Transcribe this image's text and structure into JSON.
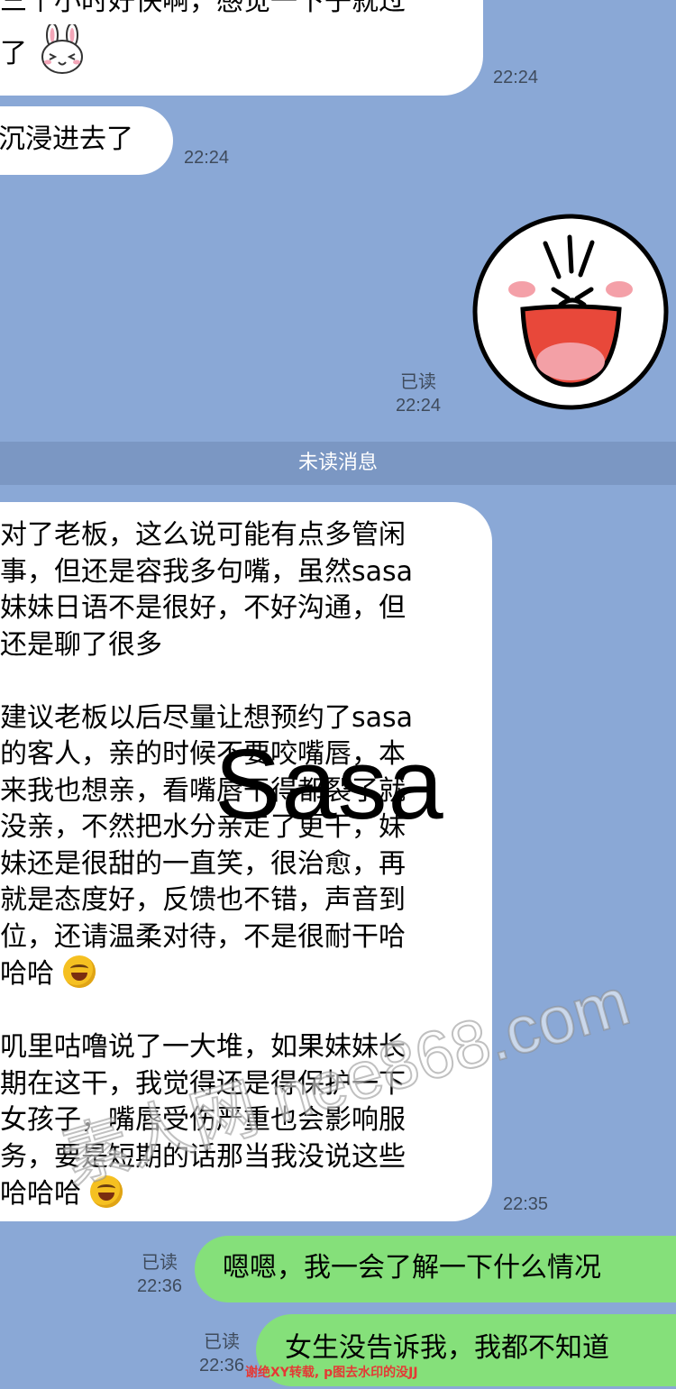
{
  "messages": {
    "m1": {
      "lines": [
        "三个小时好快啊，感觉一下子就过",
        "了"
      ],
      "time": "22:24"
    },
    "m2": {
      "text": "沉浸进去了",
      "time": "22:24"
    },
    "sticker": {
      "icon": "laughing-face-sticker",
      "read": "已读",
      "time": "22:24"
    },
    "m3": {
      "lines": [
        "对了老板，这么说可能有点多管闲",
        "事，但还是容我多句嘴，虽然sasa",
        "妹妹日语不是很好，不好沟通，但",
        "还是聊了很多",
        "",
        "建议老板以后尽量让想预约了sasa",
        "的客人，亲的时候不要咬嘴唇，本",
        "来我也想亲，看嘴唇干得都裂了就",
        "没亲，不然把水分亲走了更干，妹",
        "妹还是很甜的一直笑，很治愈，再",
        "就是态度好，反馈也不错，声音到",
        "位，还请温柔对待，不是很耐干哈",
        "哈哈",
        "",
        "叽里咕噜说了一大堆，如果妹妹长",
        "期在这干，我觉得还是得保护一下",
        "女孩子，嘴唇受伤严重也会影响服",
        "务，要是短期的话那当我没说这些",
        "哈哈哈"
      ],
      "time": "22:35"
    },
    "m4": {
      "text": "嗯嗯，我一会了解一下什么情况",
      "read": "已读",
      "time": "22:36"
    },
    "m5": {
      "text": "女生没告诉我，我都不知道",
      "read": "已读",
      "time": "22:36"
    }
  },
  "divider_label": "未读消息",
  "watermarks": {
    "name": "Sasa",
    "url": "素人网 nee868.com"
  },
  "footer_note": "谢绝XY转载, p图去水印的没JJ",
  "colors": {
    "background": "#8aa8d6",
    "incoming": "#ffffff",
    "outgoing": "#85e07a",
    "divider": "#7b97c3"
  }
}
